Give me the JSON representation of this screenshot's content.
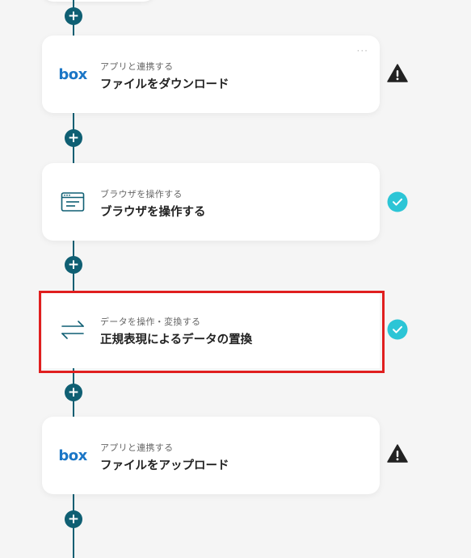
{
  "steps": [
    {
      "subtitle": "アプリと連携する",
      "title": "ファイルをダウンロード",
      "icon": "box-logo-icon",
      "logo_text": "box",
      "status": "warning"
    },
    {
      "subtitle": "ブラウザを操作する",
      "title": "ブラウザを操作する",
      "icon": "browser-window-icon",
      "status": "success"
    },
    {
      "subtitle": "データを操作・変換する",
      "title": "正規表現によるデータの置換",
      "icon": "swap-arrows-icon",
      "status": "success"
    },
    {
      "subtitle": "アプリと連携する",
      "title": "ファイルをアップロード",
      "icon": "box-logo-icon",
      "logo_text": "box",
      "status": "warning"
    }
  ],
  "more_label": "···",
  "add_label": "+",
  "colors": {
    "connector": "#0f5f73",
    "success": "#2cc5d6",
    "warning": "#222222",
    "highlight": "#e01f1f",
    "box_brand": "#1b76c6"
  }
}
